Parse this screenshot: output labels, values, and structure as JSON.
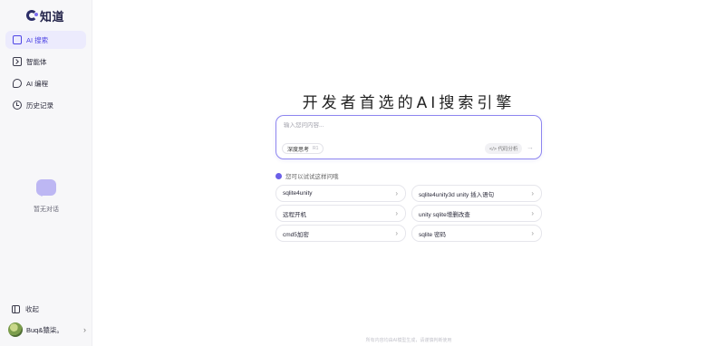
{
  "brand": {
    "name": "知道"
  },
  "sidebar": {
    "items": [
      {
        "label": "AI 搜索",
        "icon": "search-icon",
        "active": true
      },
      {
        "label": "智能体",
        "icon": "terminal-icon",
        "active": false
      },
      {
        "label": "AI 编程",
        "icon": "chat-icon",
        "active": false
      },
      {
        "label": "历史记录",
        "icon": "clock-icon",
        "active": false
      }
    ],
    "empty_text": "暂无对话",
    "collapse_label": "收起",
    "user": {
      "name": "Buq&猿柒。"
    }
  },
  "main": {
    "hero": "开发者首选的AI搜索引擎",
    "search": {
      "placeholder": "输入您问内容...",
      "deep_label": "深度思考",
      "deep_badge": "R1",
      "code_label": "</> 代码分析",
      "send_label": "→"
    },
    "hint": "您可以试试这样问哦",
    "suggestions": [
      "sqlite4unity",
      "sqlite4unity3d unity 插入语句",
      "远程开机",
      "unity sqlite增删改查",
      "cmd5加密",
      "sqlite 密码"
    ],
    "footer": "所有内容均由AI模型生成，请谨慎判断使用"
  },
  "colors": {
    "accent": "#4f46e5",
    "border_accent": "#8e86f0"
  }
}
